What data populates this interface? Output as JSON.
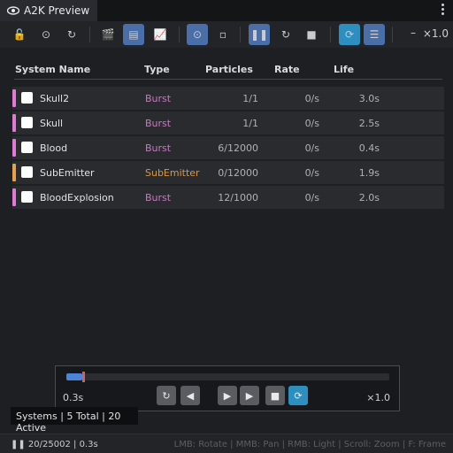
{
  "window": {
    "tab_title": "A2K Preview",
    "tab_icon": "eye-icon",
    "menu_icon": "kebab-menu-icon"
  },
  "toolbar": {
    "buttons": [
      {
        "name": "lock-icon",
        "glyph": "🔓"
      },
      {
        "name": "target-icon",
        "glyph": "⊙"
      },
      {
        "name": "reset-icon",
        "glyph": "↻"
      },
      {
        "name": "clapper-icon",
        "glyph": "🎬"
      },
      {
        "name": "document-icon",
        "glyph": "▤"
      },
      {
        "name": "chart-icon",
        "glyph": "📈"
      },
      {
        "name": "sphere-icon",
        "glyph": "⊙"
      },
      {
        "name": "square-icon",
        "glyph": "▫"
      },
      {
        "name": "pause-icon",
        "glyph": "❚❚"
      },
      {
        "name": "restart-icon",
        "glyph": "↻"
      },
      {
        "name": "stop-icon",
        "glyph": "■"
      },
      {
        "name": "loop-icon",
        "glyph": "⟳"
      },
      {
        "name": "list-icon",
        "glyph": "☰"
      }
    ],
    "minus": "–",
    "zoom": "×1.0"
  },
  "table": {
    "headers": {
      "name": "System Name",
      "type": "Type",
      "particles": "Particles",
      "rate": "Rate",
      "life": "Life"
    },
    "rows": [
      {
        "name": "Skull2",
        "type": "Burst",
        "particles": "1/1",
        "rate": "0/s",
        "life": "3.0s",
        "stripe": "#e07ad6",
        "type_color": "#c97ac2"
      },
      {
        "name": "Skull",
        "type": "Burst",
        "particles": "1/1",
        "rate": "0/s",
        "life": "2.5s",
        "stripe": "#e07ad6",
        "type_color": "#c97ac2"
      },
      {
        "name": "Blood",
        "type": "Burst",
        "particles": "6/12000",
        "rate": "0/s",
        "life": "0.4s",
        "stripe": "#e07ad6",
        "type_color": "#c97ac2"
      },
      {
        "name": "SubEmitter",
        "type": "SubEmitter",
        "particles": "0/12000",
        "rate": "0/s",
        "life": "1.9s",
        "stripe": "#e8a04a",
        "type_color": "#e0953d"
      },
      {
        "name": "BloodExplosion",
        "type": "Burst",
        "particles": "12/1000",
        "rate": "0/s",
        "life": "2.0s",
        "stripe": "#e07ad6",
        "type_color": "#c97ac2"
      }
    ]
  },
  "timeline": {
    "progress": 0.05,
    "time": "0.3s",
    "speed": "×1.0",
    "controls": [
      {
        "name": "restart-icon",
        "glyph": "↻"
      },
      {
        "name": "step-back-icon",
        "glyph": "◀"
      },
      {
        "name": "play-icon",
        "glyph": "▶"
      },
      {
        "name": "step-forward-icon",
        "glyph": "▶"
      },
      {
        "name": "stop-icon",
        "glyph": "■"
      },
      {
        "name": "loop-icon",
        "glyph": "⟳"
      }
    ]
  },
  "badge": "Systems | 5 Total | 20 Active",
  "statusbar": {
    "left": "❚❚ 20/25002 | 0.3s",
    "hints": "LMB: Rotate | MMB: Pan | RMB: Light | Scroll: Zoom | F: Frame"
  }
}
